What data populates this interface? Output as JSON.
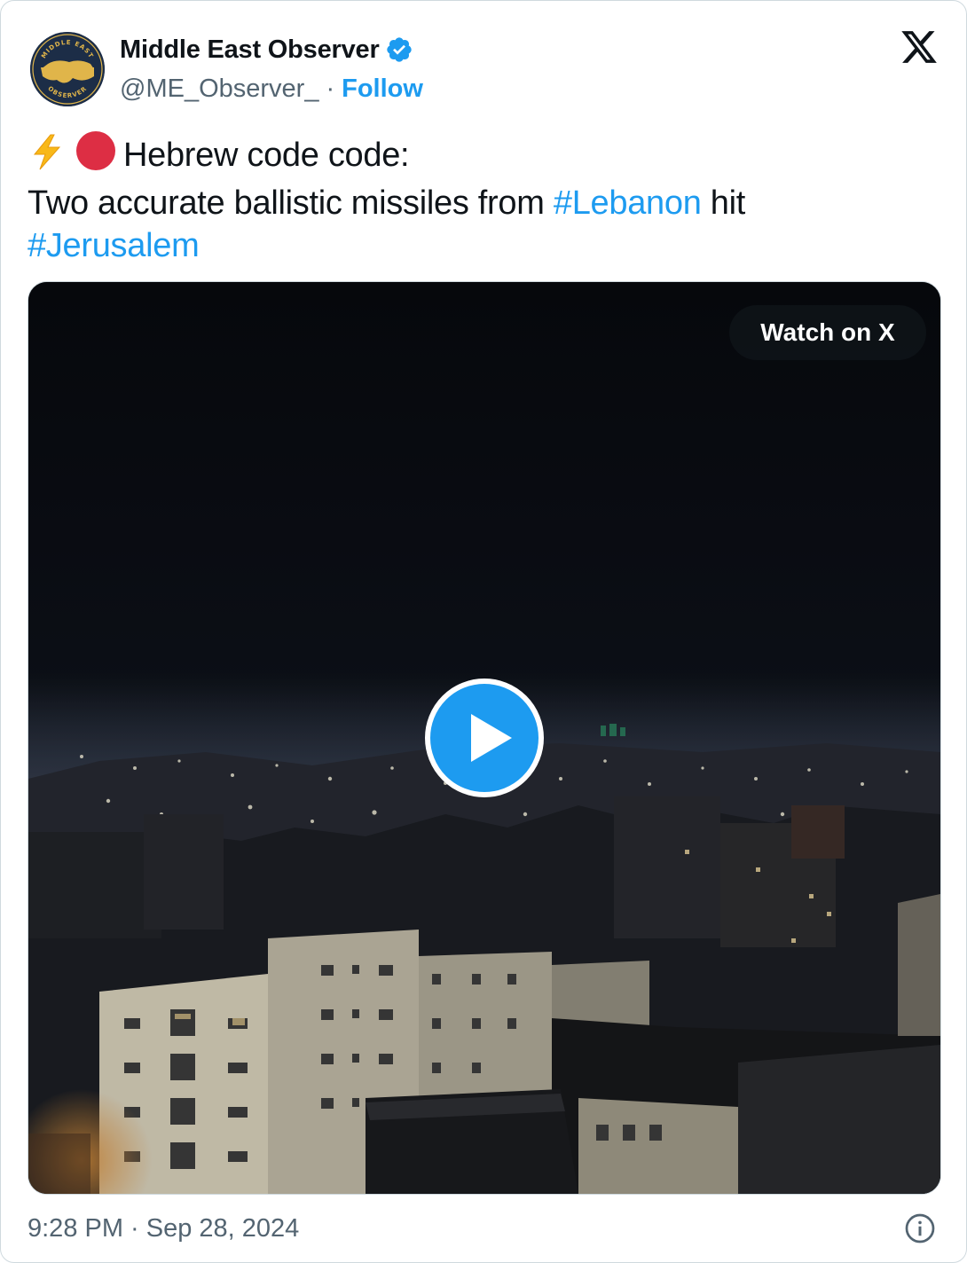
{
  "author": {
    "display_name": "Middle East Observer",
    "handle": "@ME_Observer_",
    "separator": "·",
    "follow_label": "Follow",
    "verified": true,
    "avatar_text_top": "MIDDLE EAST",
    "avatar_text_bottom": "OBSERVER"
  },
  "tweet": {
    "line1_text": "Hebrew code code:",
    "line2_text": "Two accurate ballistic missiles from",
    "hashtag1": "#Lebanon",
    "line2_suffix": "hit",
    "hashtag2": "#Jerusalem",
    "emojis": [
      "lightning-emoji",
      "red-circle-emoji"
    ]
  },
  "media": {
    "type": "video",
    "watch_label": "Watch on X"
  },
  "footer": {
    "timestamp": "9:28 PM · Sep 28, 2024"
  },
  "colors": {
    "link": "#1d9bf0",
    "text": "#0f1419",
    "muted": "#536471",
    "border": "#cfd9de",
    "avatar_bg": "#1c2d47",
    "avatar_gold": "#e0b54a"
  },
  "icons": {
    "brand": "x-logo-icon",
    "verified": "verified-badge-icon",
    "play": "play-icon",
    "info": "info-icon"
  }
}
